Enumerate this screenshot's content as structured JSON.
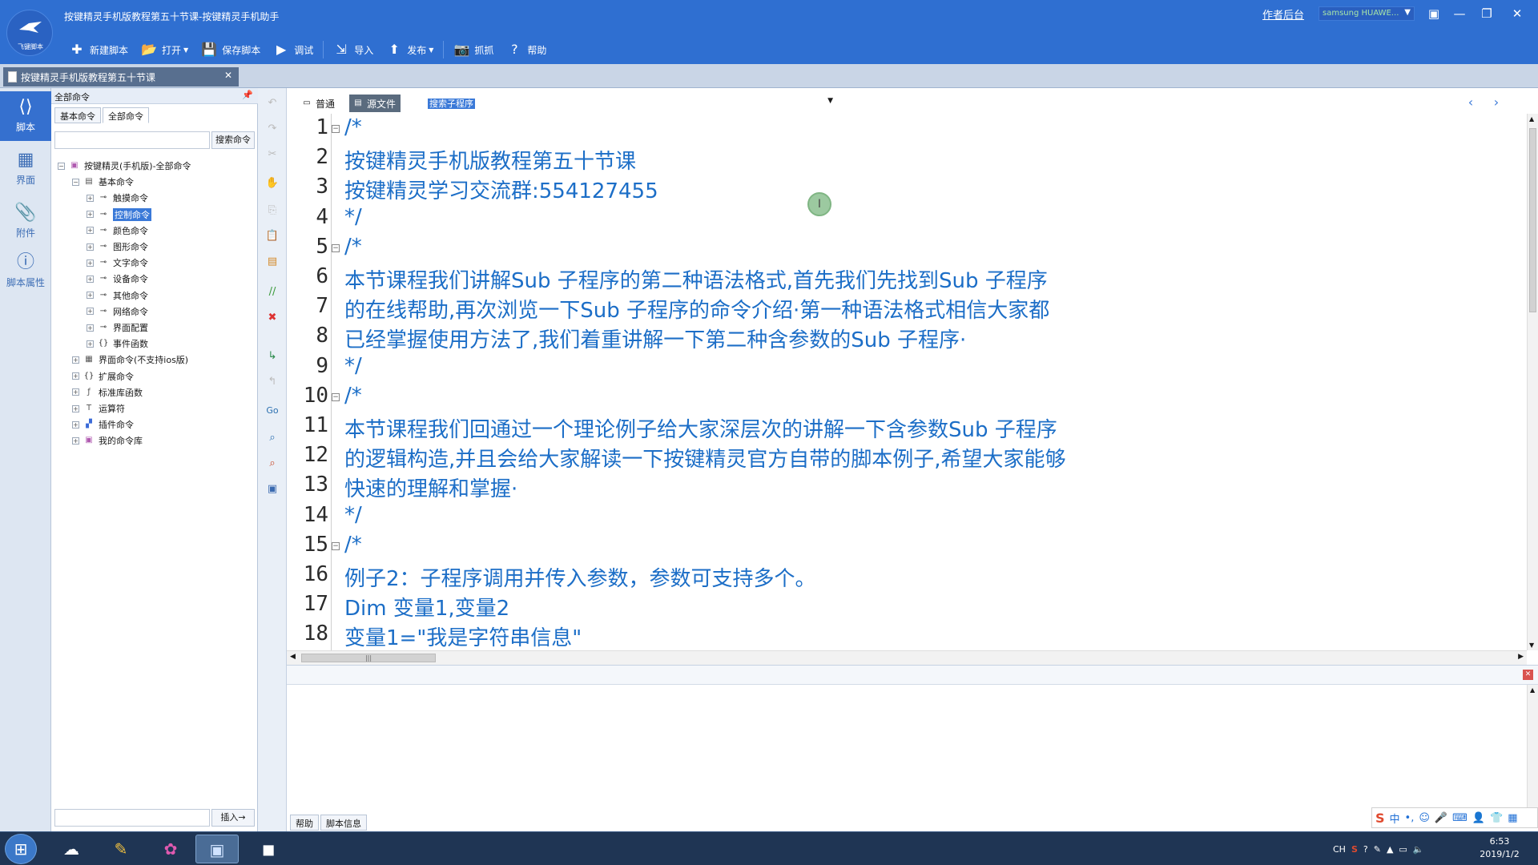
{
  "window": {
    "title": "按键精灵手机版教程第五十节课-按键精灵手机助手",
    "logo_text": "飞键脚本",
    "homework_link": "作者后台",
    "device": "samsung HUAWE..."
  },
  "toolbar": [
    {
      "label": "新建脚本",
      "icon": "plus-icon"
    },
    {
      "label": "打开",
      "icon": "folder-icon",
      "dropdown": true
    },
    {
      "label": "保存脚本",
      "icon": "save-icon"
    },
    {
      "label": "调试",
      "icon": "play-icon"
    },
    {
      "label": "导入",
      "icon": "import-icon"
    },
    {
      "label": "发布",
      "icon": "publish-icon",
      "dropdown": true
    },
    {
      "label": "抓抓",
      "icon": "camera-icon"
    },
    {
      "label": "帮助",
      "icon": "help-icon"
    }
  ],
  "doc_tab": {
    "label": "按键精灵手机版教程第五十节课"
  },
  "leftnav": [
    {
      "label": "脚本",
      "icon": "script-icon",
      "active": true
    },
    {
      "label": "界面",
      "icon": "grid-icon",
      "active": false
    },
    {
      "label": "附件",
      "icon": "attachment-icon",
      "active": false
    },
    {
      "label": "脚本属性",
      "icon": "info-icon",
      "active": false
    }
  ],
  "cmdpanel": {
    "header": "全部命令",
    "tabs": [
      "基本命令",
      "全部命令"
    ],
    "search_button": "搜索命令",
    "insert_button": "插入→",
    "tree": [
      {
        "label": "按键精灵(手机版)-全部命令",
        "level": 0,
        "expander": "−",
        "icon": "library-icon"
      },
      {
        "label": "基本命令",
        "level": 1,
        "expander": "−",
        "icon": "command-group-icon"
      },
      {
        "label": "触摸命令",
        "level": 2,
        "expander": "+",
        "icon": "key-icon"
      },
      {
        "label": "控制命令",
        "level": 2,
        "expander": "+",
        "icon": "key-icon",
        "selected": true
      },
      {
        "label": "颜色命令",
        "level": 2,
        "expander": "+",
        "icon": "key-icon"
      },
      {
        "label": "图形命令",
        "level": 2,
        "expander": "+",
        "icon": "key-icon"
      },
      {
        "label": "文字命令",
        "level": 2,
        "expander": "+",
        "icon": "key-icon"
      },
      {
        "label": "设备命令",
        "level": 2,
        "expander": "+",
        "icon": "key-icon"
      },
      {
        "label": "其他命令",
        "level": 2,
        "expander": "+",
        "icon": "key-icon"
      },
      {
        "label": "网络命令",
        "level": 2,
        "expander": "+",
        "icon": "key-icon"
      },
      {
        "label": "界面配置",
        "level": 2,
        "expander": "+",
        "icon": "key-icon"
      },
      {
        "label": "事件函数",
        "level": 2,
        "expander": "+",
        "icon": "braces-icon"
      },
      {
        "label": "界面命令(不支持ios版)",
        "level": 1,
        "expander": "+",
        "icon": "ui-icon"
      },
      {
        "label": "扩展命令",
        "level": 1,
        "expander": "+",
        "icon": "braces-icon"
      },
      {
        "label": "标准库函数",
        "level": 1,
        "expander": "+",
        "icon": "function-icon"
      },
      {
        "label": "运算符",
        "level": 1,
        "expander": "+",
        "icon": "operator-icon"
      },
      {
        "label": "插件命令",
        "level": 1,
        "expander": "+",
        "icon": "plugin-icon"
      },
      {
        "label": "我的命令库",
        "level": 1,
        "expander": "+",
        "icon": "library-icon"
      }
    ]
  },
  "editor": {
    "modes": [
      {
        "label": "普通",
        "active": false
      },
      {
        "label": "源文件",
        "active": true
      }
    ],
    "sub_select": "搜索子程序",
    "lines": [
      {
        "n": "1",
        "text": "/*",
        "fold": true
      },
      {
        "n": "2",
        "text": "按键精灵手机版教程第五十节课"
      },
      {
        "n": "3",
        "text": "按键精灵学习交流群:554127455"
      },
      {
        "n": "4",
        "text": "*/"
      },
      {
        "n": "5",
        "text": "/*",
        "fold": true
      },
      {
        "n": "6",
        "text": "本节课程我们讲解Sub 子程序的第二种语法格式,首先我们先找到Sub 子程序"
      },
      {
        "n": "7",
        "text": "的在线帮助,再次浏览一下Sub 子程序的命令介绍·第一种语法格式相信大家都"
      },
      {
        "n": "8",
        "text": "已经掌握使用方法了,我们着重讲解一下第二种含参数的Sub 子程序·"
      },
      {
        "n": "9",
        "text": "*/"
      },
      {
        "n": "10",
        "text": "/*",
        "fold": true
      },
      {
        "n": "11",
        "text": "本节课程我们回通过一个理论例子给大家深层次的讲解一下含参数Sub 子程序"
      },
      {
        "n": "12",
        "text": "的逻辑构造,并且会给大家解读一下按键精灵官方自带的脚本例子,希望大家能够"
      },
      {
        "n": "13",
        "text": "快速的理解和掌握·"
      },
      {
        "n": "14",
        "text": "*/"
      },
      {
        "n": "15",
        "text": "/*",
        "fold": true
      },
      {
        "n": "16",
        "text": "例子2：子程序调用并传入参数，参数可支持多个。"
      },
      {
        "n": "17",
        "text": "Dim 变量1,变量2"
      },
      {
        "n": "18",
        "text": "变量1=\"我是字符串信息\""
      }
    ]
  },
  "bottom_panel": {
    "tabs": [
      "帮助",
      "脚本信息"
    ]
  },
  "taskbar": {
    "apps": [
      "start-icon",
      "baidu-netdisk-icon",
      "pen-tool-icon",
      "color-wheel-icon",
      "remote-desktop-icon",
      "nox-emulator-icon"
    ],
    "tray_lang": "CH",
    "time": "6:53",
    "date": "2019/1/2"
  },
  "ime": {
    "label": "中"
  }
}
